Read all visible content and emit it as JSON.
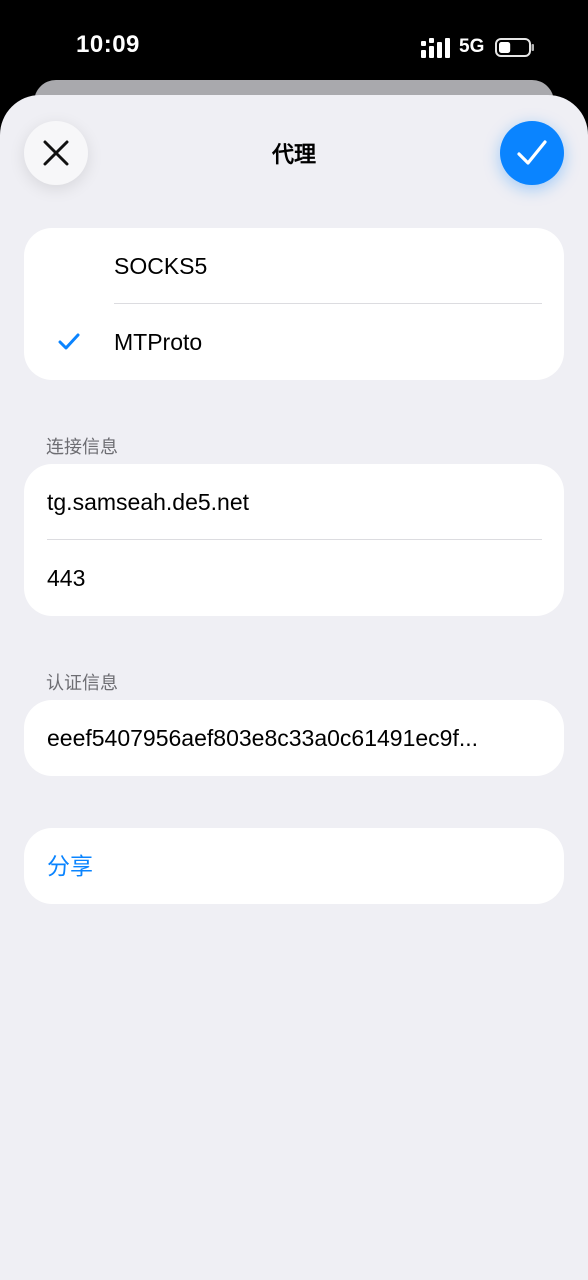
{
  "status_bar": {
    "time": "10:09",
    "network": "5G",
    "battery_fraction": 0.4
  },
  "header": {
    "title": "代理"
  },
  "proxy_types": [
    {
      "label": "SOCKS5",
      "selected": false
    },
    {
      "label": "MTProto",
      "selected": true
    }
  ],
  "connection": {
    "section_label": "连接信息",
    "server": "tg.samseah.de5.net",
    "port": "443"
  },
  "auth": {
    "section_label": "认证信息",
    "secret": "eeef5407956aef803e8c33a0c61491ec9f..."
  },
  "actions": {
    "share_label": "分享"
  },
  "colors": {
    "accent": "#0a84ff",
    "background": "#efeff4",
    "card": "#ffffff"
  }
}
